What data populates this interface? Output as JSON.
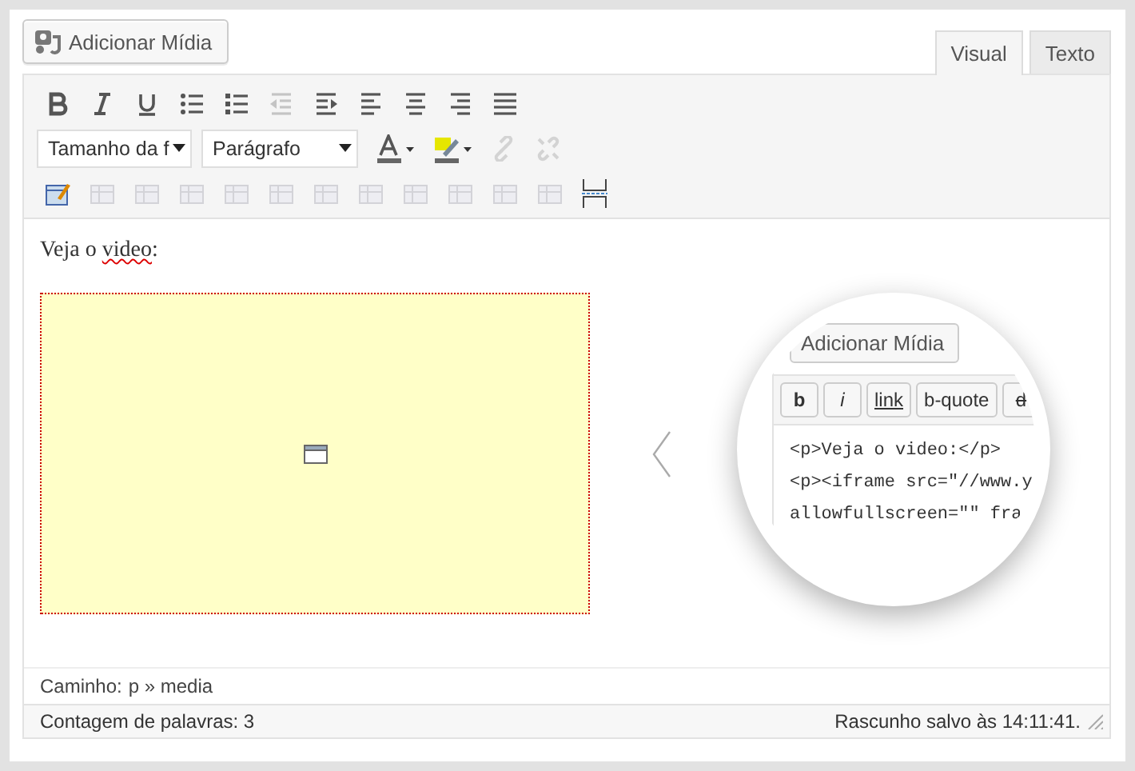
{
  "media_button": {
    "label": "Adicionar Mídia"
  },
  "tabs": [
    {
      "label": "Visual",
      "selected": true
    },
    {
      "label": "Texto",
      "selected": false
    }
  ],
  "toolbar_row_1": [
    {
      "disabled": false
    },
    {
      "disabled": false
    },
    {
      "disabled": false
    },
    {
      "disabled": false
    },
    {
      "disabled": false
    },
    {
      "disabled": true
    },
    {
      "disabled": false
    },
    {
      "disabled": false
    },
    {
      "disabled": false
    },
    {
      "disabled": false
    },
    {
      "disabled": false
    }
  ],
  "font_size_select": {
    "value": "Tamanho da f"
  },
  "format_select": {
    "value": "Parágrafo"
  },
  "toolbar_row_2": [
    {
      "disabled": false
    },
    {
      "disabled": false
    },
    {
      "disabled": true
    },
    {
      "disabled": true
    }
  ],
  "toolbar_row_3": [
    {
      "disabled": false
    },
    {
      "disabled": true
    },
    {
      "disabled": true
    },
    {
      "disabled": true
    },
    {
      "disabled": true
    },
    {
      "disabled": true
    },
    {
      "disabled": true
    },
    {
      "disabled": true
    },
    {
      "disabled": true
    },
    {
      "disabled": true
    },
    {
      "disabled": true
    },
    {
      "disabled": true
    },
    {
      "disabled": false
    }
  ],
  "content": {
    "paragraph": [
      {
        "text": "Veja o ",
        "misspelled": false
      },
      {
        "text": "video",
        "misspelled": true
      },
      {
        "text": ":",
        "misspelled": false
      }
    ]
  },
  "magnifier": {
    "media_button": {
      "label": "Adicionar Mídia"
    },
    "quicktags": [
      {
        "label": "b",
        "kind": "bold"
      },
      {
        "label": "i",
        "kind": "italic"
      },
      {
        "label": "link",
        "kind": "link"
      },
      {
        "label": "b-quote",
        "kind": "plain"
      },
      {
        "label": "d",
        "kind": "strike"
      }
    ],
    "code_lines": [
      "<p>Veja o video:</p>",
      "<p><iframe src=\"//www.y",
      "allowfullscreen=\"\" fra"
    ]
  },
  "path_bar": {
    "label": "Caminho:",
    "path": "p » media"
  },
  "status_bar": {
    "word_count": "Contagem de palavras: 3",
    "draft_saved": "Rascunho salvo às 14:11:41."
  }
}
